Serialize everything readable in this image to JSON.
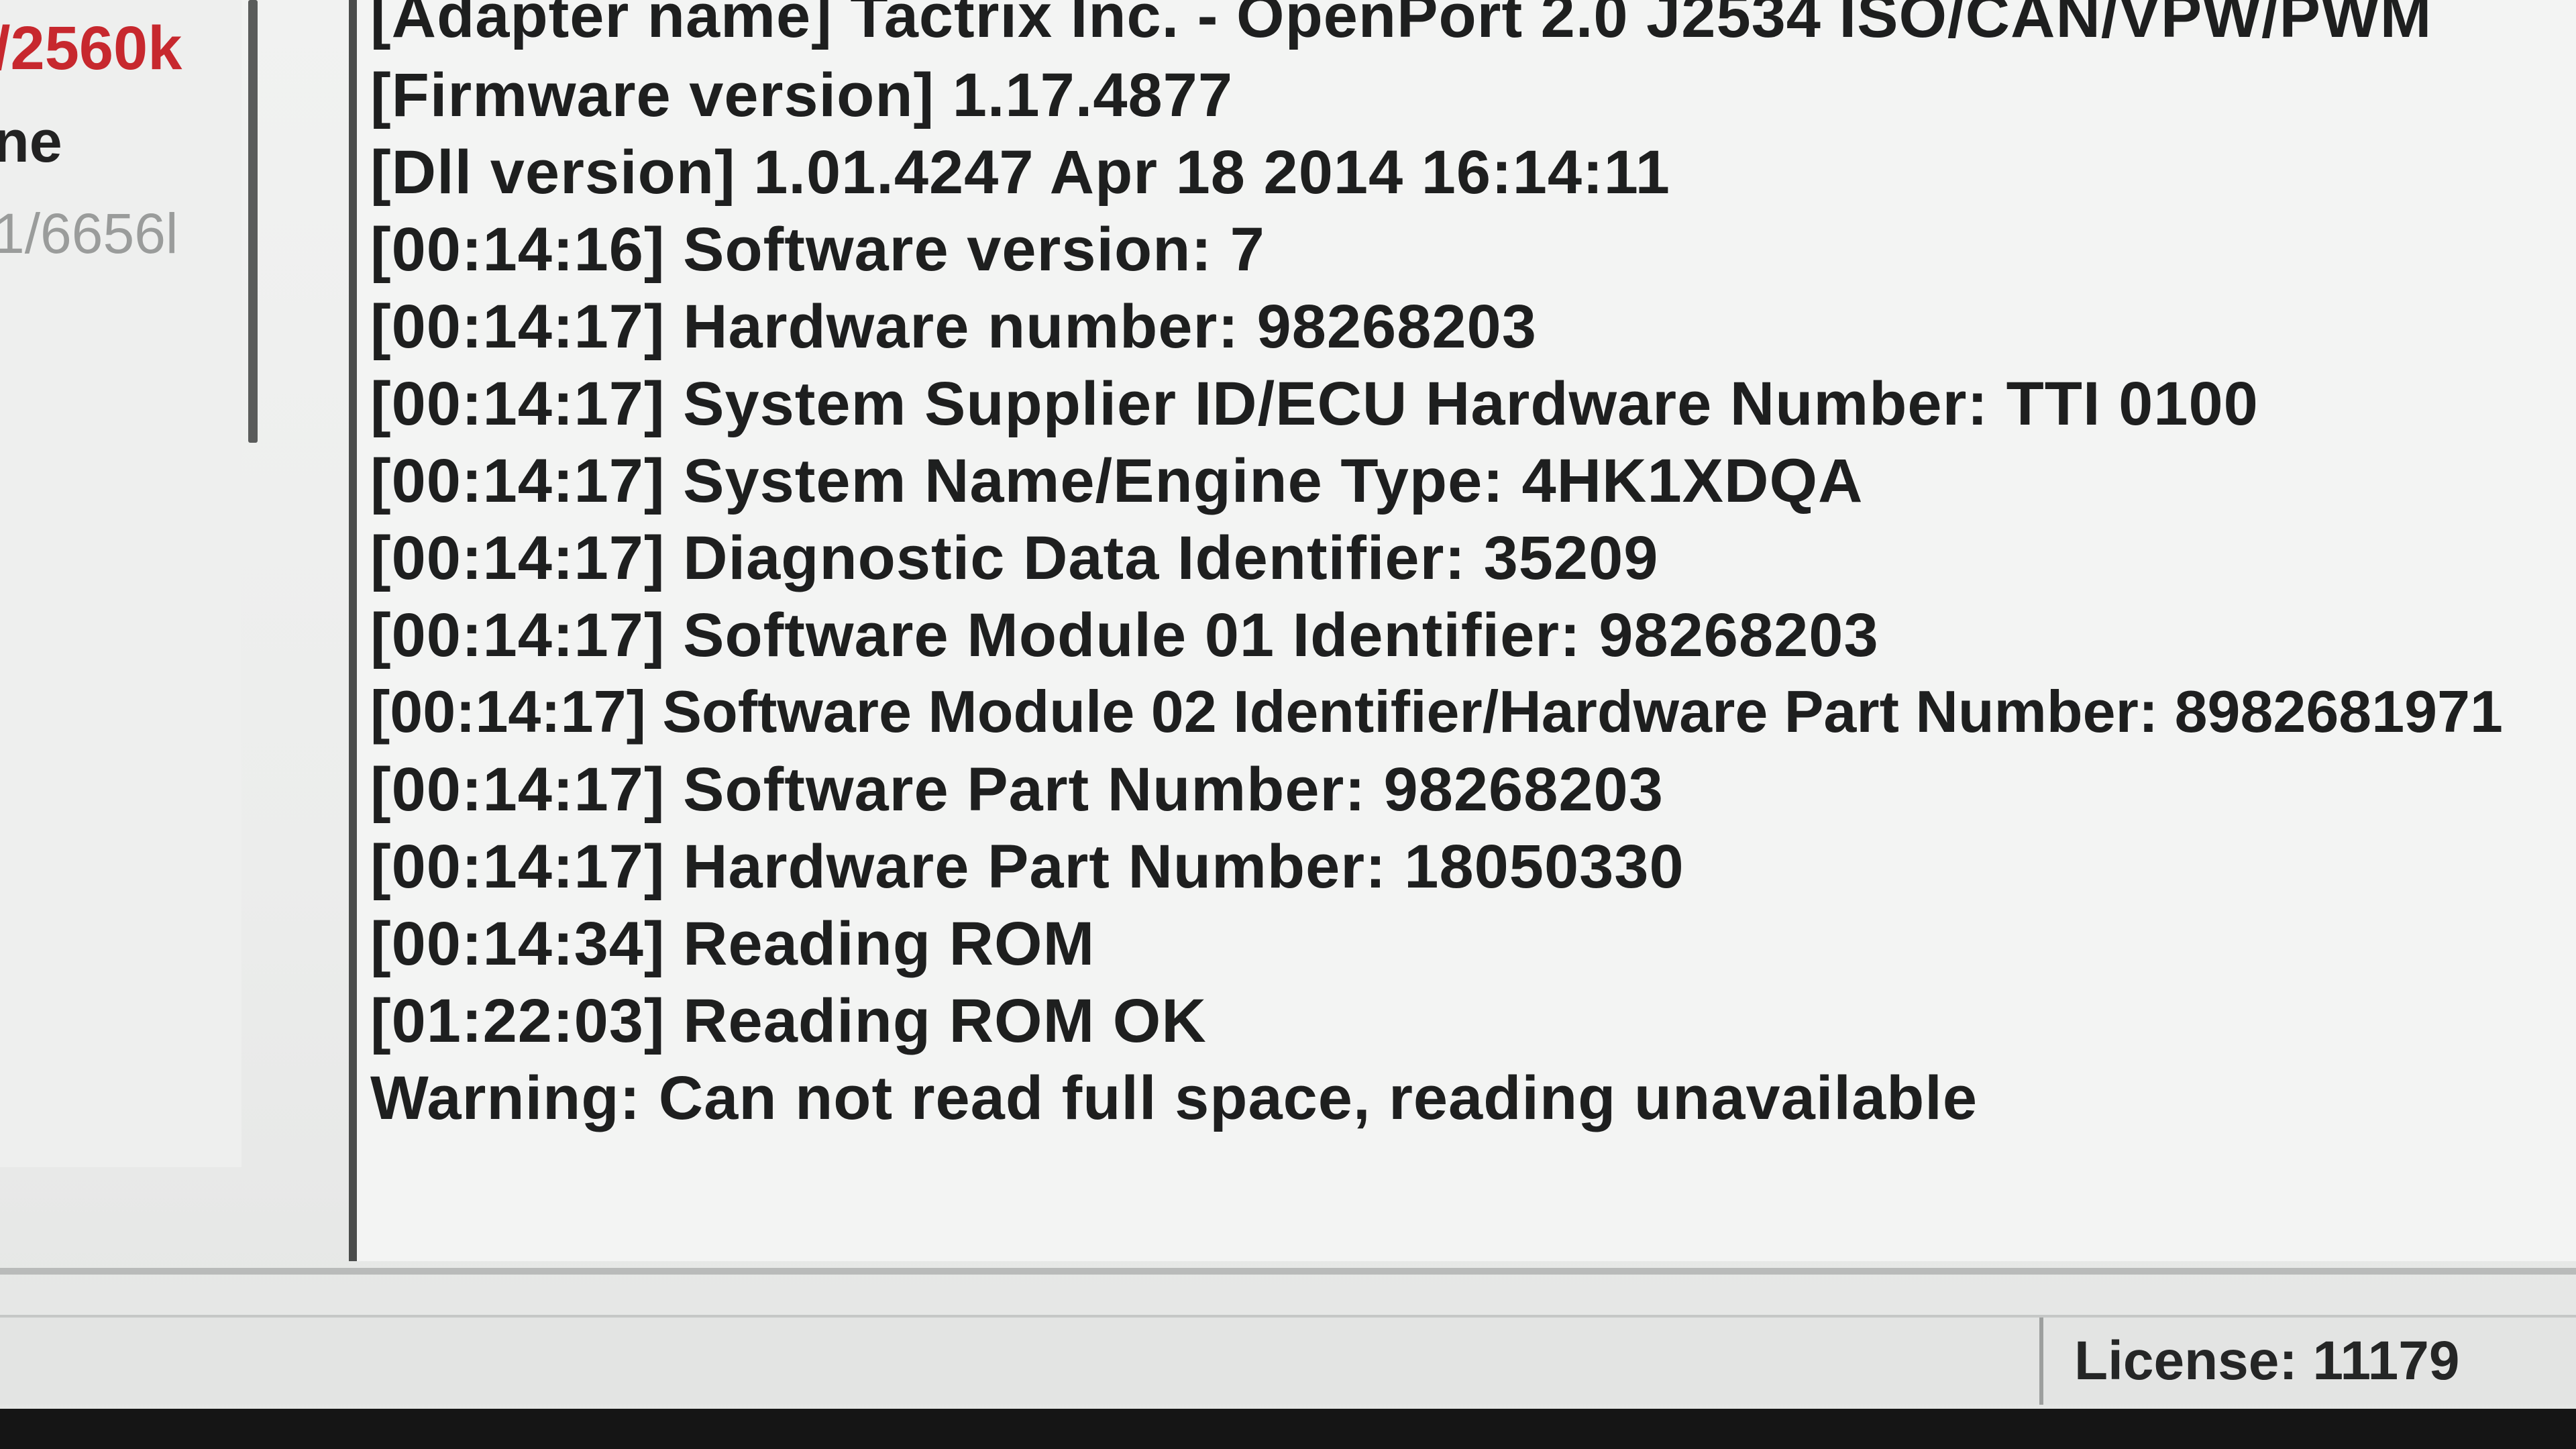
{
  "left_panel": {
    "item_speed": "/2560k",
    "item_name": "ne",
    "item_count": "1/6656l"
  },
  "log": {
    "lines": [
      "[Adapter name] Tactrix Inc. - OpenPort 2.0 J2534 ISO/CAN/VPW/PWM",
      "[Firmware version] 1.17.4877",
      "[Dll version] 1.01.4247 Apr 18 2014 16:14:11",
      "[00:14:16] Software version: 7",
      "[00:14:17] Hardware number: 98268203",
      "[00:14:17] System Supplier ID/ECU Hardware Number: TTI  0100",
      "[00:14:17] System Name/Engine Type: 4HK1XDQA",
      "[00:14:17] Diagnostic Data Identifier: 35209",
      "[00:14:17] Software Module 01 Identifier: 98268203",
      "[00:14:17] Software Module 02 Identifier/Hardware Part Number: 8982681971",
      "[00:14:17] Software Part Number: 98268203",
      "[00:14:17] Hardware Part Number: 18050330",
      "[00:14:34] Reading ROM",
      "[01:22:03] Reading ROM OK",
      "Warning: Can not read full space, reading unavailable"
    ]
  },
  "status_bar": {
    "license": "License: 11179"
  }
}
